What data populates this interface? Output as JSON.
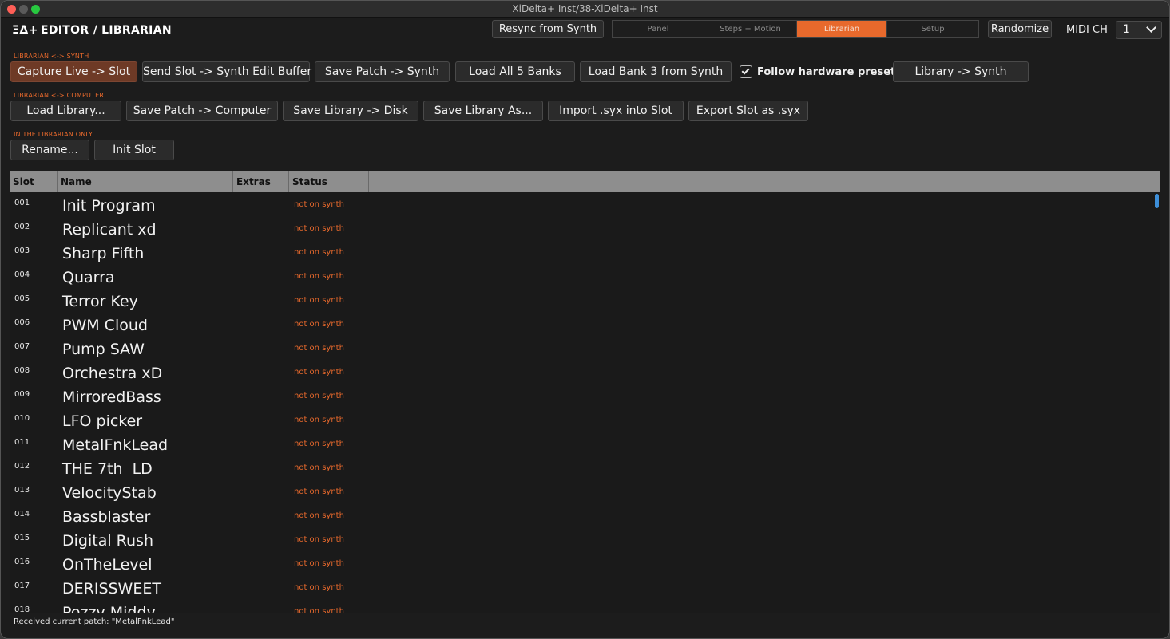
{
  "window": {
    "title": "XiDelta+ Inst/38-XiDelta+ Inst"
  },
  "header": {
    "logo": "ΞΔ+",
    "title": "EDITOR / LIBRARIAN",
    "resync_label": "Resync from Synth",
    "tabs": [
      {
        "label": "Panel",
        "active": false
      },
      {
        "label": "Steps + Motion",
        "active": false
      },
      {
        "label": "Librarian",
        "active": true
      },
      {
        "label": "Setup",
        "active": false
      }
    ],
    "randomize_label": "Randomize",
    "midi_label": "MIDI CH",
    "midi_value": "1"
  },
  "synth_section": {
    "label": "LIBRARIAN  <->  SYNTH",
    "capture_label": "Capture Live -> Slot",
    "send_slot_label": "Send Slot -> Synth Edit Buffer",
    "save_patch_synth_label": "Save Patch -> Synth",
    "load_all_label": "Load All 5 Banks",
    "load_bank_label": "Load Bank 3 from Synth",
    "follow_label": "Follow hardware presets",
    "follow_checked": true,
    "library_synth_label": "Library -> Synth"
  },
  "computer_section": {
    "label": "LIBRARIAN  <->  COMPUTER",
    "load_library_label": "Load Library...",
    "save_patch_computer_label": "Save Patch -> Computer",
    "save_library_disk_label": "Save Library -> Disk",
    "save_library_as_label": "Save Library As...",
    "import_syx_label": "Import .syx into Slot",
    "export_syx_label": "Export Slot as .syx"
  },
  "librarian_section": {
    "label": "IN THE LIBRARIAN ONLY",
    "rename_label": "Rename...",
    "init_slot_label": "Init Slot"
  },
  "table": {
    "columns": [
      "Slot",
      "Name",
      "Extras",
      "Status"
    ],
    "rows": [
      {
        "slot": "001",
        "name": "Init Program",
        "extras": "",
        "status": "not on synth"
      },
      {
        "slot": "002",
        "name": "Replicant xd",
        "extras": "",
        "status": "not on synth"
      },
      {
        "slot": "003",
        "name": "Sharp Fifth",
        "extras": "",
        "status": "not on synth"
      },
      {
        "slot": "004",
        "name": "Quarra",
        "extras": "",
        "status": "not on synth"
      },
      {
        "slot": "005",
        "name": "Terror Key",
        "extras": "",
        "status": "not on synth"
      },
      {
        "slot": "006",
        "name": "PWM Cloud",
        "extras": "",
        "status": "not on synth"
      },
      {
        "slot": "007",
        "name": "Pump SAW",
        "extras": "",
        "status": "not on synth"
      },
      {
        "slot": "008",
        "name": "Orchestra xD",
        "extras": "",
        "status": "not on synth"
      },
      {
        "slot": "009",
        "name": "MirroredBass",
        "extras": "",
        "status": "not on synth"
      },
      {
        "slot": "010",
        "name": "LFO picker",
        "extras": "",
        "status": "not on synth"
      },
      {
        "slot": "011",
        "name": "MetalFnkLead",
        "extras": "",
        "status": "not on synth"
      },
      {
        "slot": "012",
        "name": "THE 7th  LD",
        "extras": "",
        "status": "not on synth"
      },
      {
        "slot": "013",
        "name": "VelocityStab",
        "extras": "",
        "status": "not on synth"
      },
      {
        "slot": "014",
        "name": "Bassblaster",
        "extras": "",
        "status": "not on synth"
      },
      {
        "slot": "015",
        "name": "Digital Rush",
        "extras": "",
        "status": "not on synth"
      },
      {
        "slot": "016",
        "name": "OnTheLevel",
        "extras": "",
        "status": "not on synth"
      },
      {
        "slot": "017",
        "name": "DERISSWEET",
        "extras": "",
        "status": "not on synth"
      },
      {
        "slot": "018",
        "name": "Pezzy Middy",
        "extras": "",
        "status": "not on synth"
      }
    ]
  },
  "status_bar": {
    "text": "Received current patch: \"MetalFnkLead\""
  },
  "colors": {
    "accent": "#e8692c",
    "capture_button": "#6e3a26",
    "scroll_thumb": "#3d8fd9"
  }
}
